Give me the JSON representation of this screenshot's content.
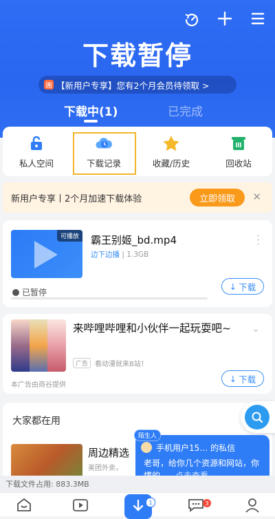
{
  "header": {
    "title": "下载暂停",
    "promo_badge": "圃",
    "promo": "【新用户专享】您有2个月会员待领取 >",
    "icons": [
      "speed-icon",
      "plus-icon",
      "menu-icon"
    ],
    "tabs": [
      {
        "label": "下载中(1)",
        "active": true
      },
      {
        "label": "已完成",
        "active": false
      }
    ]
  },
  "quick_access": [
    {
      "label": "私人空间",
      "icon": "lock-icon"
    },
    {
      "label": "下载记录",
      "icon": "cloud-clock-icon",
      "highlighted": true
    },
    {
      "label": "收藏/历史",
      "icon": "star-icon"
    },
    {
      "label": "回收站",
      "icon": "trash-icon"
    }
  ],
  "speed_banner": {
    "text": "新用户专享丨2个月加速下载体验",
    "cta": "立即领取",
    "close": "✕"
  },
  "download": {
    "tag": "可播放",
    "name": "霸王别姬_bd.mp4",
    "mode": "边下边播",
    "size": "1.3GB",
    "status": "已暂停",
    "button": "下载",
    "progress": 0
  },
  "ad": {
    "title": "来哔哩哔哩和小伙伴一起玩耍吧~",
    "tag": "广告",
    "desc": "看动漫就来B站！",
    "source": "本广告由商谷提供",
    "button": "下载"
  },
  "apps": {
    "title": "大家都在用",
    "app_name": "周边精选",
    "app_sub": "美团外卖，"
  },
  "message": {
    "tag": "陌生人",
    "header": "手机用户15… 的私信",
    "body": "老哥，给你几个资源和网站，你懂的…",
    "link": "点击查看"
  },
  "storage": {
    "text": "下载文件占用: 883.3MB"
  },
  "nav": {
    "center_badge": "1",
    "message_badge": "3"
  },
  "colors": {
    "primary": "#2f6df5",
    "accent_orange": "#f99a1b",
    "highlight_border": "#f3b32a"
  }
}
